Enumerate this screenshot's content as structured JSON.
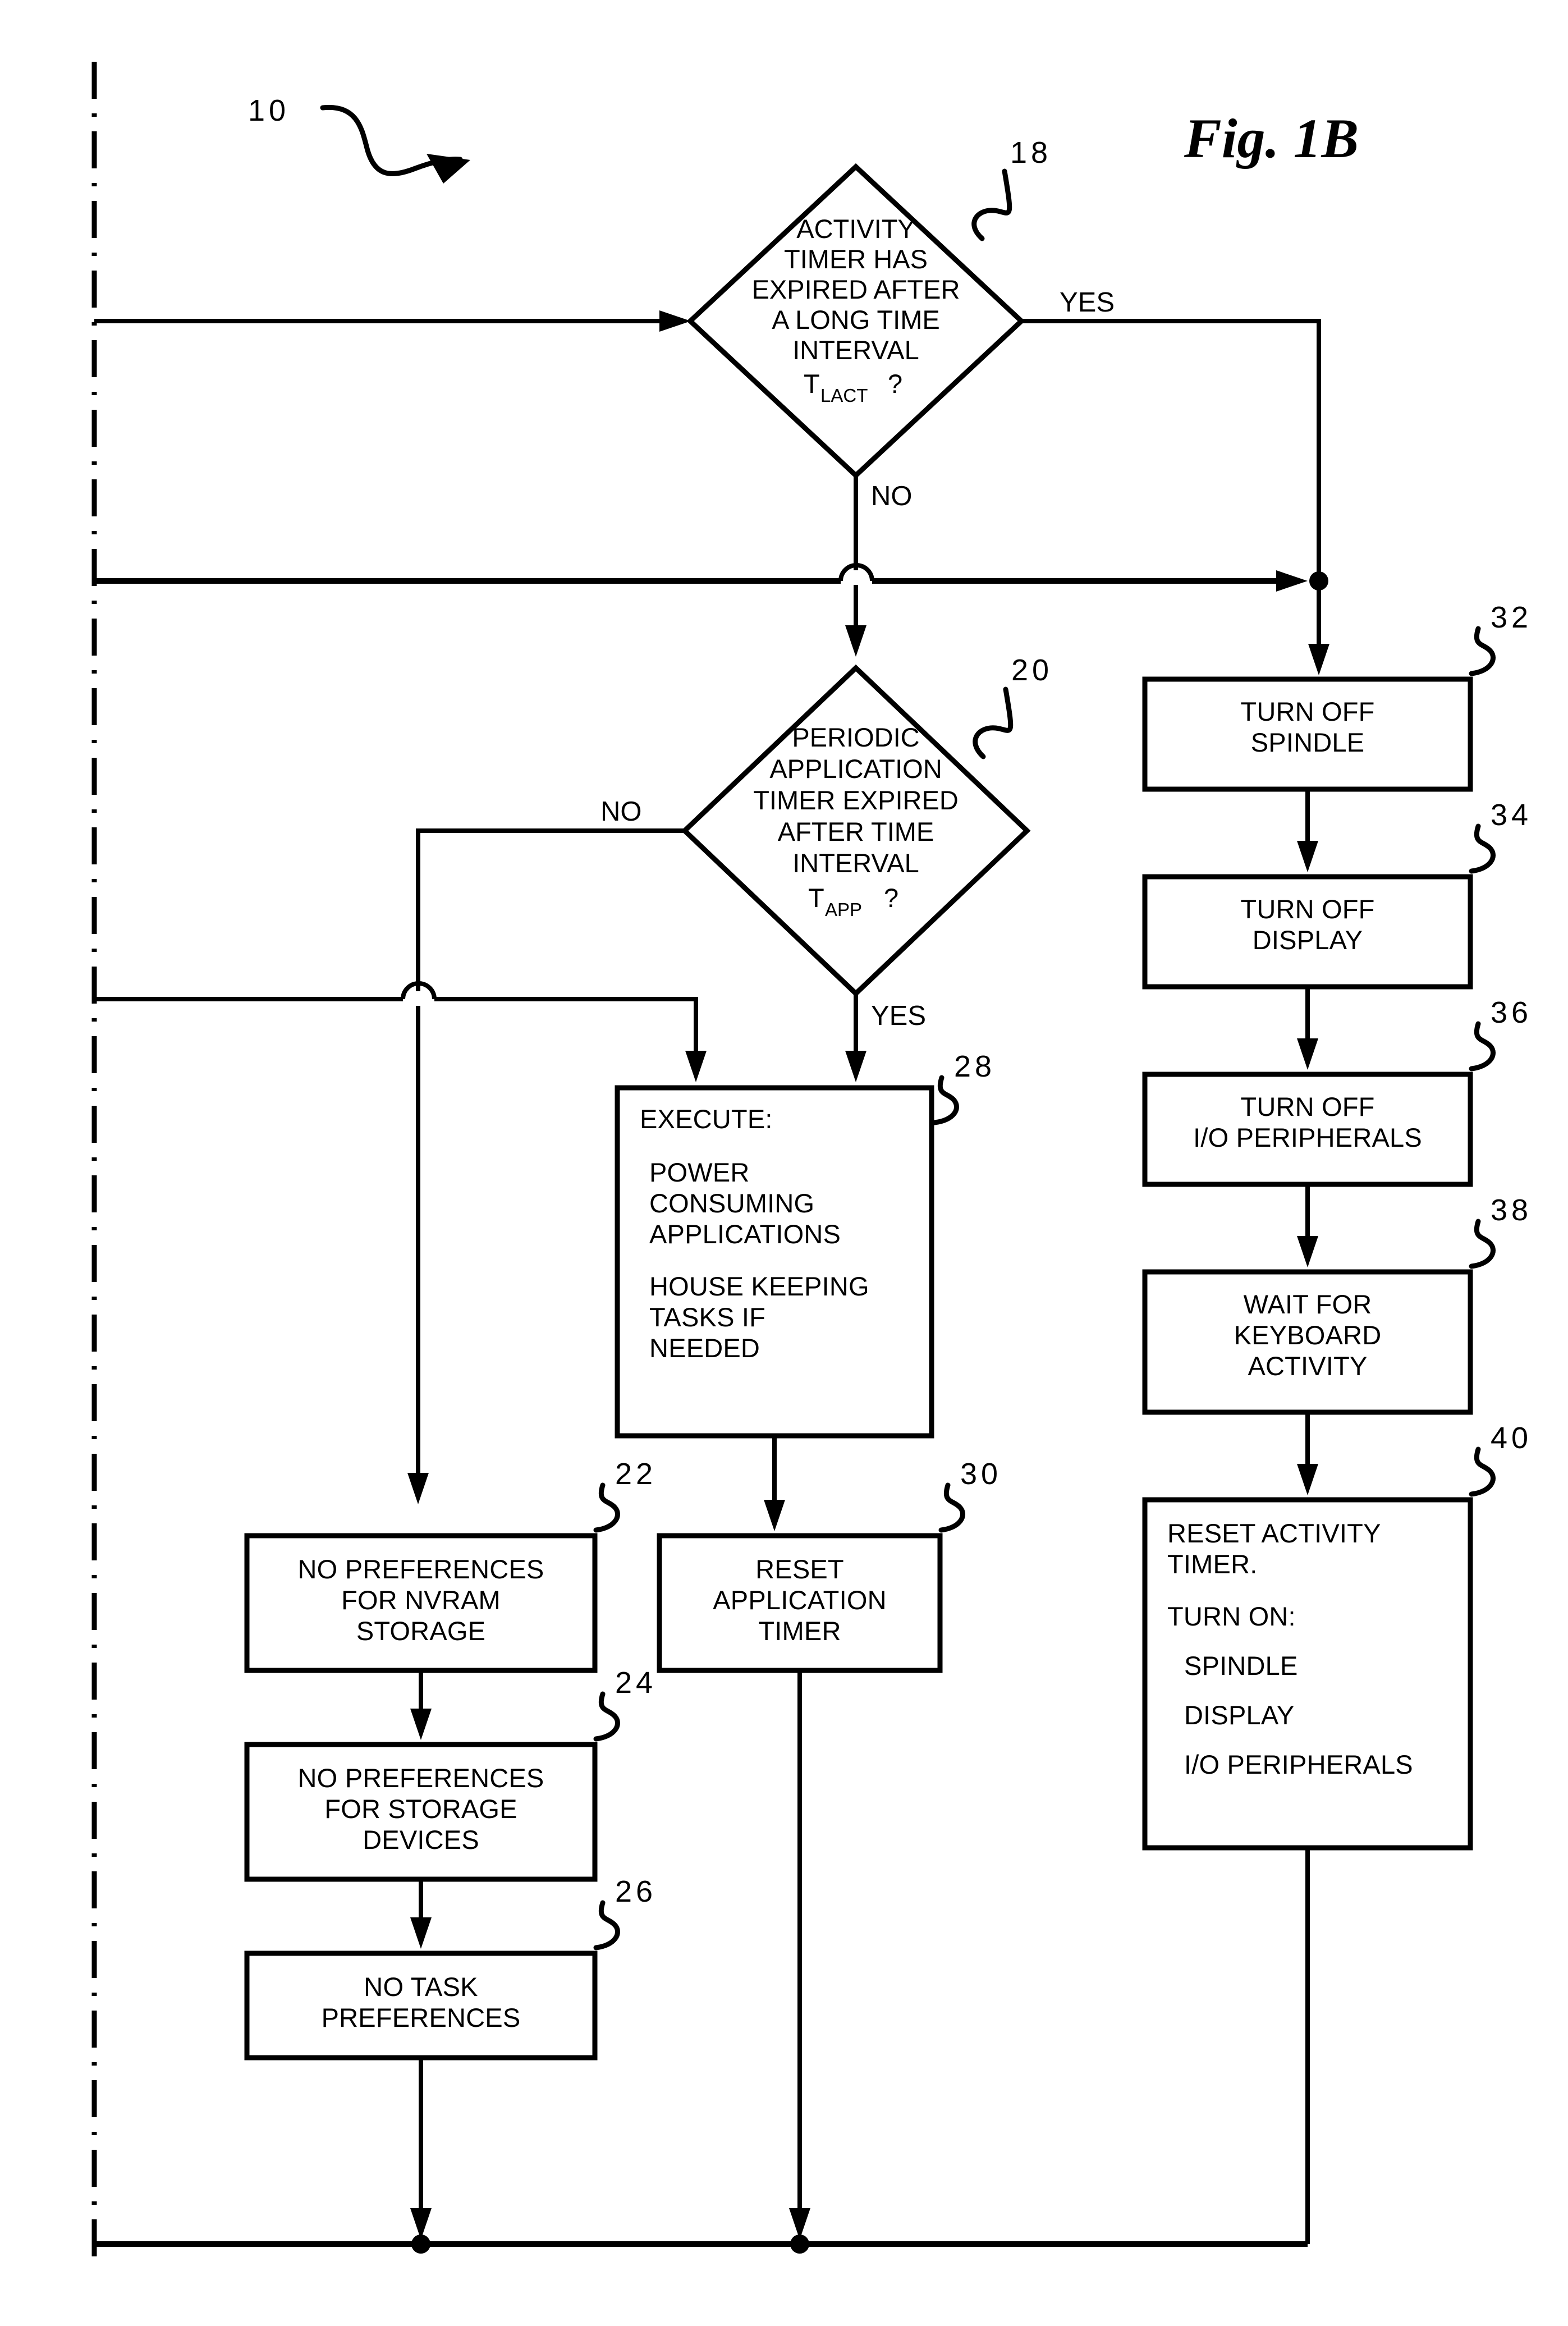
{
  "figure": {
    "title": "Fig. 1B",
    "process_ref": "10"
  },
  "edge_labels": {
    "yes": "YES",
    "no": "NO"
  },
  "nodes": [
    {
      "id": "d18",
      "ref": "18",
      "kind": "decision",
      "lines": [
        "ACTIVITY",
        "TIMER HAS",
        "EXPIRED AFTER",
        "A LONG TIME",
        "INTERVAL"
      ],
      "var_base": "T",
      "var_sub": "LACT",
      "var_tail": "?"
    },
    {
      "id": "d20",
      "ref": "20",
      "kind": "decision",
      "lines": [
        "PERIODIC",
        "APPLICATION",
        "TIMER EXPIRED",
        "AFTER TIME",
        "INTERVAL"
      ],
      "var_base": "T",
      "var_sub": "APP",
      "var_tail": "?"
    },
    {
      "id": "p28",
      "ref": "28",
      "kind": "process",
      "align": "left",
      "lines": [
        "EXECUTE:",
        "",
        "POWER",
        "CONSUMING",
        "APPLICATIONS",
        "",
        "HOUSE KEEPING",
        "TASKS IF",
        "NEEDED"
      ]
    },
    {
      "id": "p22",
      "ref": "22",
      "kind": "process",
      "align": "center",
      "lines": [
        "NO PREFERENCES",
        "FOR NVRAM",
        "STORAGE"
      ]
    },
    {
      "id": "p24",
      "ref": "24",
      "kind": "process",
      "align": "center",
      "lines": [
        "NO PREFERENCES",
        "FOR STORAGE",
        "DEVICES"
      ]
    },
    {
      "id": "p26",
      "ref": "26",
      "kind": "process",
      "align": "center",
      "lines": [
        "NO TASK",
        "PREFERENCES"
      ]
    },
    {
      "id": "p30",
      "ref": "30",
      "kind": "process",
      "align": "center",
      "lines": [
        "RESET",
        "APPLICATION",
        "TIMER"
      ]
    },
    {
      "id": "p32",
      "ref": "32",
      "kind": "process",
      "align": "center",
      "lines": [
        "TURN OFF",
        "SPINDLE"
      ]
    },
    {
      "id": "p34",
      "ref": "34",
      "kind": "process",
      "align": "center",
      "lines": [
        "TURN OFF",
        "DISPLAY"
      ]
    },
    {
      "id": "p36",
      "ref": "36",
      "kind": "process",
      "align": "center",
      "lines": [
        "TURN OFF",
        "I/O PERIPHERALS"
      ]
    },
    {
      "id": "p38",
      "ref": "38",
      "kind": "process",
      "align": "center",
      "lines": [
        "WAIT FOR",
        "KEYBOARD",
        "ACTIVITY"
      ]
    },
    {
      "id": "p40",
      "ref": "40",
      "kind": "process",
      "align": "left",
      "lines": [
        "RESET ACTIVITY",
        "TIMER.",
        "",
        "TURN ON:",
        "",
        "SPINDLE",
        "",
        "DISPLAY",
        "",
        "I/O PERIPHERALS"
      ]
    }
  ],
  "text": {
    "d18_l0": "ACTIVITY",
    "d18_l1": "TIMER HAS",
    "d18_l2": "EXPIRED AFTER",
    "d18_l3": "A LONG TIME",
    "d18_l4": "INTERVAL",
    "d18_var": "T",
    "d18_sub": "LACT",
    "d18_q": "?",
    "d20_l0": "PERIODIC",
    "d20_l1": "APPLICATION",
    "d20_l2": "TIMER EXPIRED",
    "d20_l3": "AFTER TIME",
    "d20_l4": "INTERVAL",
    "d20_var": "T",
    "d20_sub": "APP",
    "d20_q": "?",
    "p28_l0": "EXECUTE:",
    "p28_l1": "POWER",
    "p28_l2": "CONSUMING",
    "p28_l3": "APPLICATIONS",
    "p28_l4": "HOUSE KEEPING",
    "p28_l5": "TASKS IF",
    "p28_l6": "NEEDED",
    "p22_l0": "NO PREFERENCES",
    "p22_l1": "FOR NVRAM",
    "p22_l2": "STORAGE",
    "p24_l0": "NO PREFERENCES",
    "p24_l1": "FOR STORAGE",
    "p24_l2": "DEVICES",
    "p26_l0": "NO TASK",
    "p26_l1": "PREFERENCES",
    "p30_l0": "RESET",
    "p30_l1": "APPLICATION",
    "p30_l2": "TIMER",
    "p32_l0": "TURN OFF",
    "p32_l1": "SPINDLE",
    "p34_l0": "TURN OFF",
    "p34_l1": "DISPLAY",
    "p36_l0": "TURN OFF",
    "p36_l1": "I/O PERIPHERALS",
    "p38_l0": "WAIT FOR",
    "p38_l1": "KEYBOARD",
    "p38_l2": "ACTIVITY",
    "p40_l0": "RESET ACTIVITY",
    "p40_l1": "TIMER.",
    "p40_l2": "TURN ON:",
    "p40_l3": "SPINDLE",
    "p40_l4": "DISPLAY",
    "p40_l5": "I/O PERIPHERALS",
    "ref_10": "10",
    "ref_18": "18",
    "ref_20": "20",
    "ref_22": "22",
    "ref_24": "24",
    "ref_26": "26",
    "ref_28": "28",
    "ref_30": "30",
    "ref_32": "32",
    "ref_34": "34",
    "ref_36": "36",
    "ref_38": "38",
    "ref_40": "40",
    "yes_18": "YES",
    "no_18": "NO",
    "no_20": "NO",
    "yes_20": "YES",
    "fig_title": "Fig. 1B"
  }
}
